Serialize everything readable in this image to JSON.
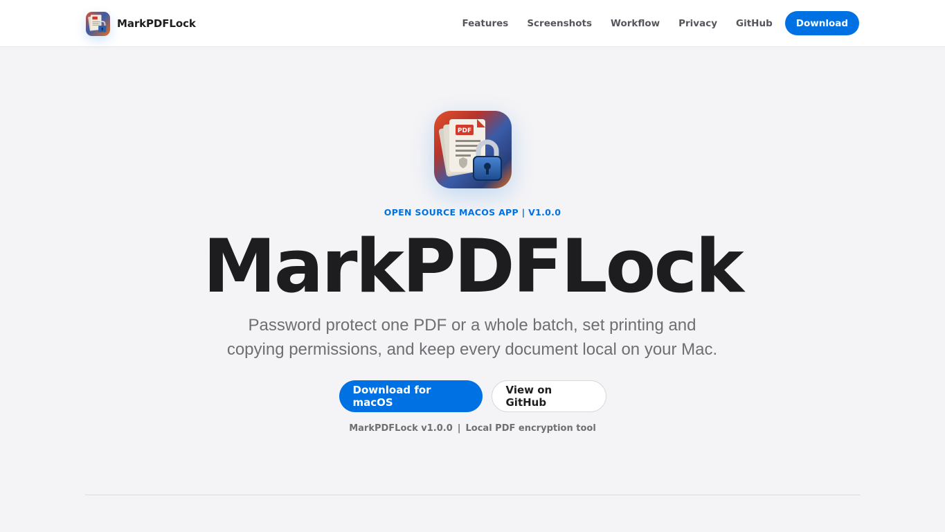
{
  "header": {
    "brand_name": "MarkPDFLock",
    "brand_icon": "app-icon-pdf-lock",
    "nav": [
      {
        "label": "Features"
      },
      {
        "label": "Screenshots"
      },
      {
        "label": "Workflow"
      },
      {
        "label": "Privacy"
      },
      {
        "label": "GitHub"
      }
    ],
    "cta_label": "Download"
  },
  "hero": {
    "icon": "app-icon-pdf-lock",
    "icon_badge_text": "PDF",
    "eyebrow": "OPEN SOURCE MACOS APP | V1.0.0",
    "title": "MarkPDFLock",
    "subtitle_line1": "Password protect one PDF or a whole batch, set printing and",
    "subtitle_line2": "copying permissions, and keep every document local on your Mac.",
    "primary_button": "Download for macOS",
    "secondary_button": "View on GitHub",
    "meta_version": "MarkPDFLock v1.0.0",
    "meta_separator": "|",
    "meta_description": "Local PDF encryption tool"
  },
  "colors": {
    "accent": "#0071e3",
    "background": "#f4f4f6",
    "text": "#1d1d1f",
    "muted": "#6e6e73"
  }
}
